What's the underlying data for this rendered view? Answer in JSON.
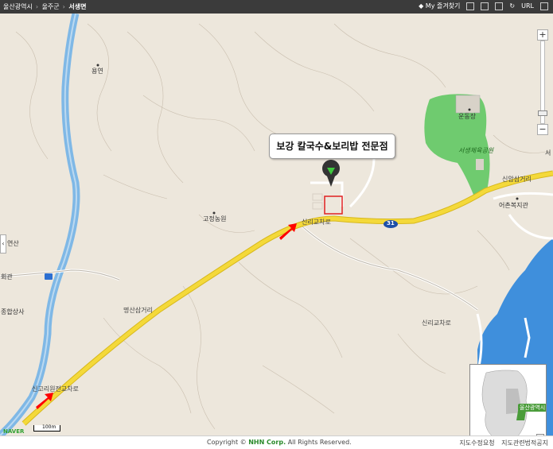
{
  "breadcrumb": {
    "items": [
      "울산광역시",
      "울주군",
      "서생면"
    ]
  },
  "toolbar": {
    "favorites_label": "My 즐겨찾기",
    "url_label": "URL"
  },
  "callout": {
    "title": "보강 칼국수&보리밥 전문점"
  },
  "places": {
    "yongyeon": "용연",
    "gojeong_farm": "고정농원",
    "undongjang": "운동장",
    "seosaeng_park": "서생체육공원",
    "eochon_welfare": "어촌복지관",
    "yeonsan": "연산",
    "hoegwan": "회관",
    "jonghap_sangsa": "종합상사",
    "seo_edge": "서"
  },
  "roads": {
    "sinri_junction": "신리교차로",
    "sinam_junction": "신암삼거리",
    "myeongsan_junction": "명산삼거리",
    "sinri_road": "신리교차로",
    "singori_junction": "신고리원전교차로",
    "route_number": "31"
  },
  "colors": {
    "land": "#ede7dc",
    "water": "#3f8fdc",
    "river": "#7fb8e6",
    "highway": "#f4d93a",
    "park": "#6fcb6f",
    "marker_red": "#e02020",
    "arrow_red": "#ff0000"
  },
  "icons": {
    "pin": "map-pin-icon",
    "arrows": "red-arrow-icon"
  },
  "minimap": {
    "label": "울산광역시"
  },
  "scale": {
    "label": "100m"
  },
  "logo": {
    "text": "NAVER"
  },
  "footer": {
    "copyright_prefix": "Copyright ©",
    "company": "NHN Corp.",
    "copyright_suffix": "All Rights Reserved.",
    "link_report": "지도수정요청",
    "link_legal": "지도관련법적공지"
  }
}
